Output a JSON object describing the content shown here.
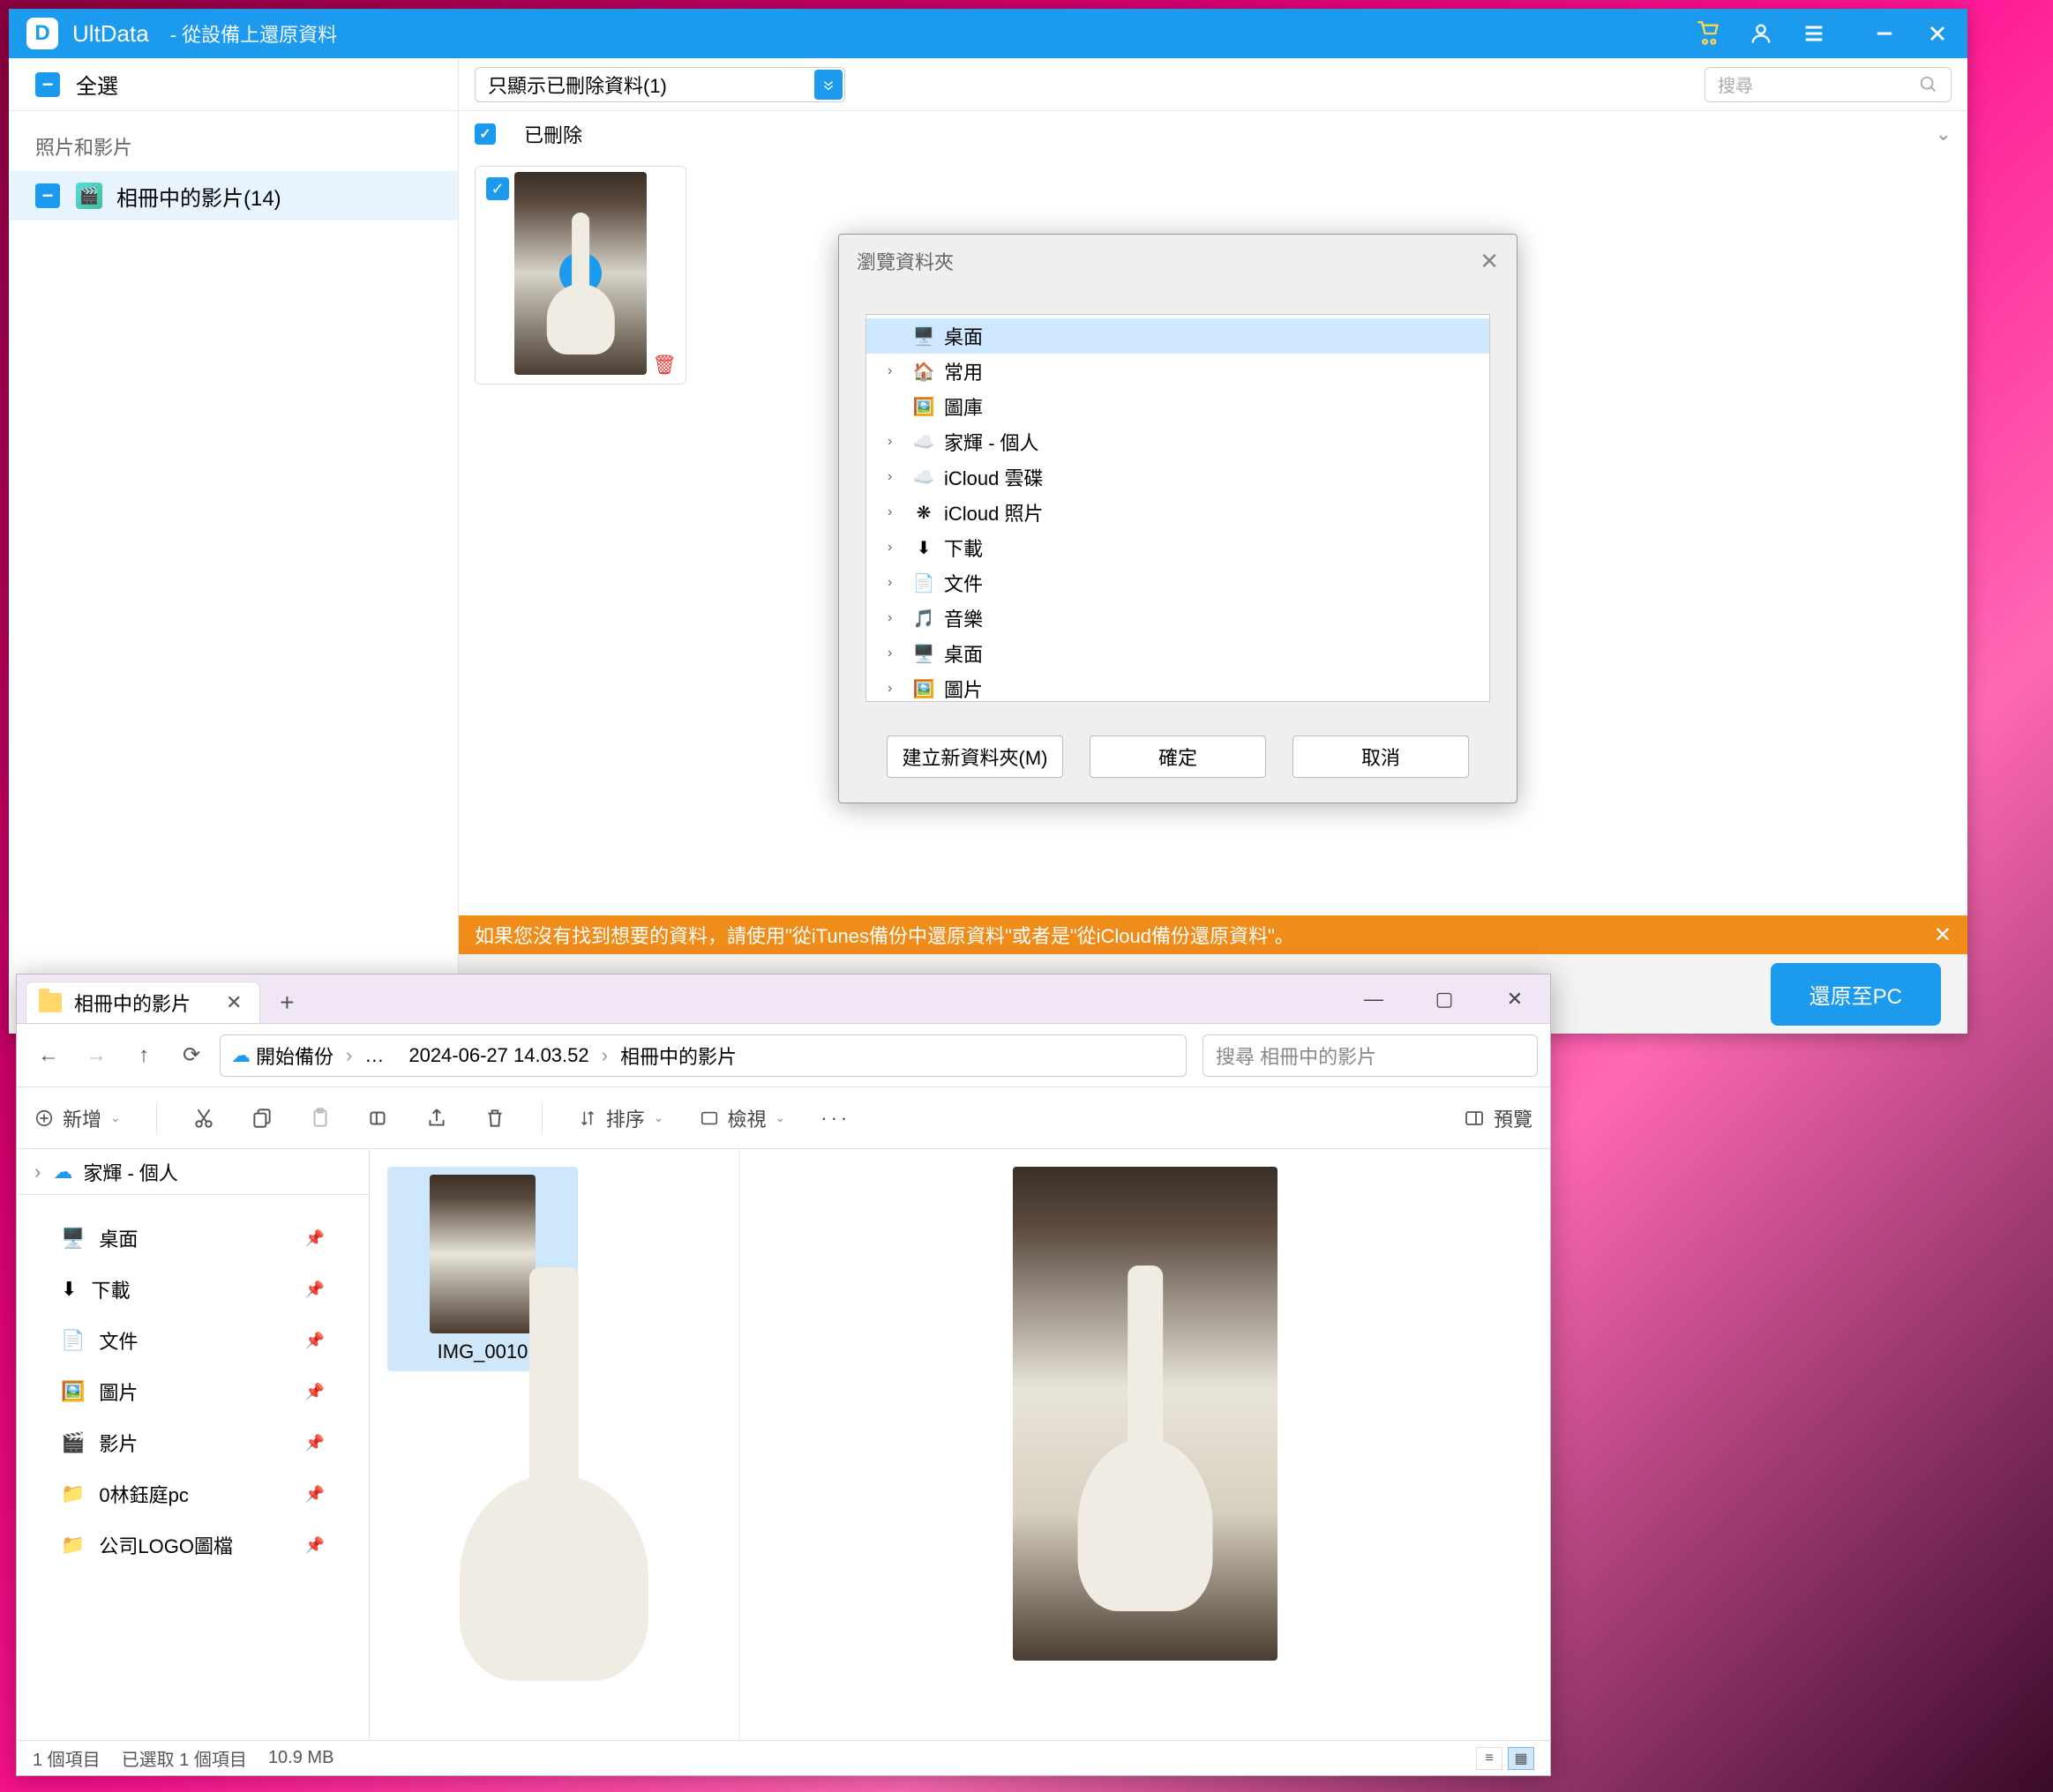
{
  "ultdata": {
    "app_name": "UltData",
    "subtitle": "-   從設備上還原資料",
    "select_all": "全選",
    "sidebar": {
      "category_label": "照片和影片",
      "item_label": "相冊中的影片(14)"
    },
    "filter": {
      "selected": "只顯示已刪除資料(1)",
      "search_placeholder": "搜尋"
    },
    "section_deleted": "已刪除",
    "hint": "如果您沒有找到想要的資料，請使用\"從iTunes備份中還原資料\"或者是\"從iCloud備份還原資料\"。",
    "recover_btn": "還原至PC"
  },
  "browse_dialog": {
    "title": "瀏覽資料夾",
    "tree": [
      {
        "label": "桌面",
        "icon": "🖥️",
        "selected": true,
        "expand": ""
      },
      {
        "label": "常用",
        "icon": "🏠",
        "expand": "›"
      },
      {
        "label": "圖庫",
        "icon": "🖼️",
        "expand": ""
      },
      {
        "label": "家輝 - 個人",
        "icon": "☁️",
        "expand": "›"
      },
      {
        "label": "iCloud 雲碟",
        "icon": "☁️",
        "expand": "›"
      },
      {
        "label": "iCloud 照片",
        "icon": "❋",
        "expand": "›"
      },
      {
        "label": "下載",
        "icon": "⬇",
        "expand": "›"
      },
      {
        "label": "文件",
        "icon": "📄",
        "expand": "›"
      },
      {
        "label": "音樂",
        "icon": "🎵",
        "expand": "›"
      },
      {
        "label": "桌面",
        "icon": "🖥️",
        "expand": "›"
      },
      {
        "label": "圖片",
        "icon": "🖼️",
        "expand": "›"
      }
    ],
    "new_folder": "建立新資料夾(M)",
    "ok": "確定",
    "cancel": "取消"
  },
  "explorer": {
    "tab_title": "相冊中的影片",
    "breadcrumb": {
      "root": "開始備份",
      "mid": "…",
      "date": "2024-06-27 14.03.52",
      "leaf": "相冊中的影片"
    },
    "search_placeholder": "搜尋 相冊中的影片",
    "toolbar": {
      "new": "新增",
      "sort": "排序",
      "view": "檢視",
      "preview": "預覽"
    },
    "sidebar_top": "家輝 - 個人",
    "nav_items": [
      {
        "label": "桌面",
        "icon": "🖥️"
      },
      {
        "label": "下載",
        "icon": "⬇"
      },
      {
        "label": "文件",
        "icon": "📄"
      },
      {
        "label": "圖片",
        "icon": "🖼️"
      },
      {
        "label": "影片",
        "icon": "🎬"
      },
      {
        "label": "0林鈺庭pc",
        "icon": "📁"
      },
      {
        "label": "公司LOGO圖檔",
        "icon": "📁"
      }
    ],
    "file_name": "IMG_0010",
    "status": {
      "count": "1 個項目",
      "selected": "已選取 1 個項目",
      "size": "10.9 MB"
    }
  }
}
